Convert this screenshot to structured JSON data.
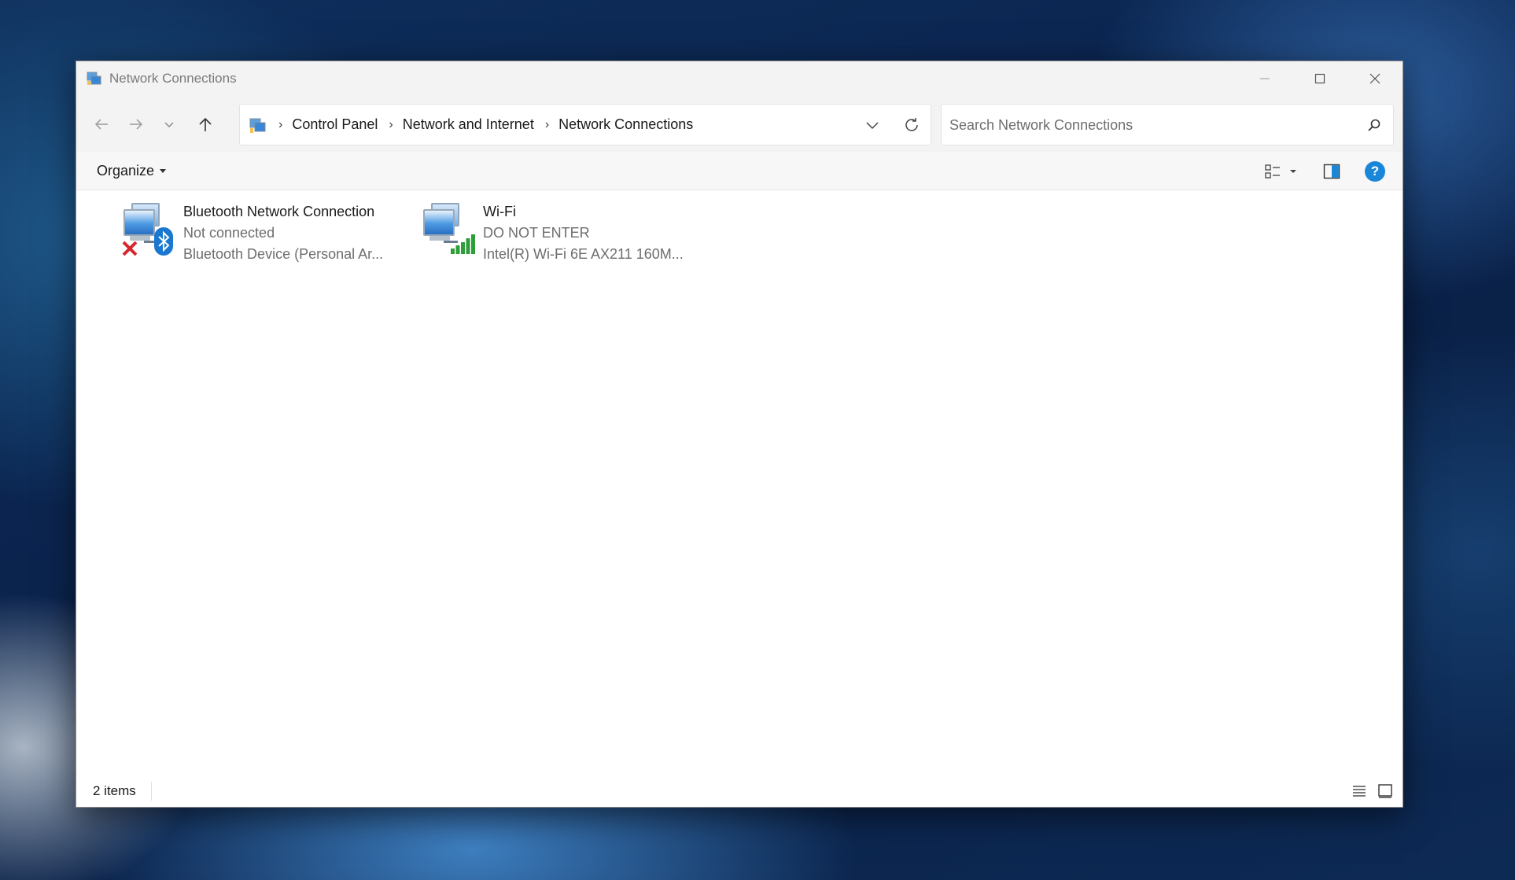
{
  "window": {
    "title": "Network Connections"
  },
  "nav": {
    "breadcrumbs": [
      "Control Panel",
      "Network and Internet",
      "Network Connections"
    ],
    "search_placeholder": "Search Network Connections"
  },
  "toolbar": {
    "organize_label": "Organize",
    "help_label": "?"
  },
  "items": [
    {
      "name": "Bluetooth Network Connection",
      "status": "Not connected",
      "device": "Bluetooth Device (Personal Ar...",
      "icon": "bluetooth-network-icon",
      "overlay": "disconnected-x"
    },
    {
      "name": "Wi-Fi",
      "status": "DO NOT ENTER",
      "device": "Intel(R) Wi-Fi 6E AX211 160M...",
      "icon": "wifi-network-icon",
      "overlay": "signal-bars"
    }
  ],
  "statusbar": {
    "item_count": "2 items"
  },
  "colors": {
    "accent": "#1a86d8",
    "error_red": "#d6262e",
    "signal_green": "#2e9e3a"
  }
}
